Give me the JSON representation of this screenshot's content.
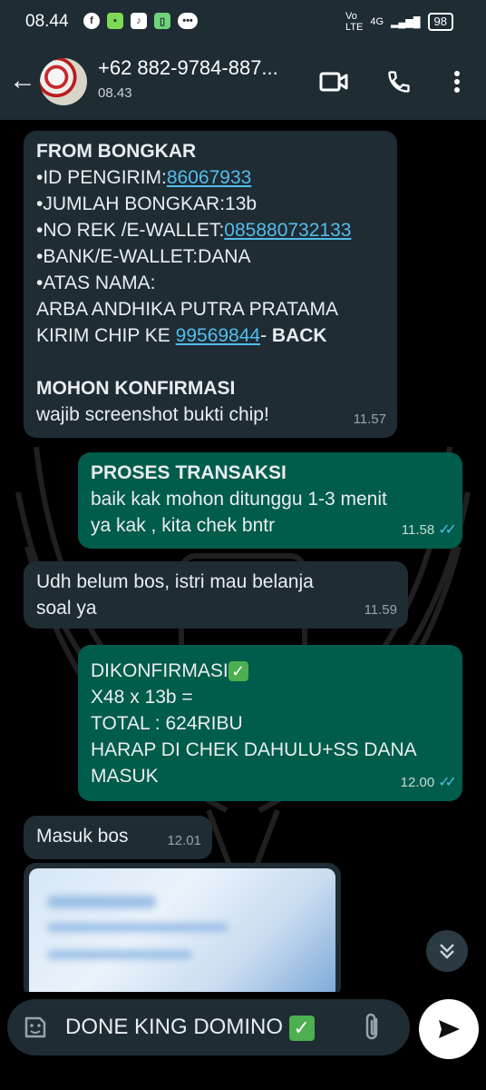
{
  "status_bar": {
    "time": "08.44",
    "network": "4G",
    "battery": "98"
  },
  "header": {
    "contact": "+62 882-9784-887...",
    "last_seen": "08.43"
  },
  "messages": [
    {
      "direction": "in",
      "title": "FROM BONGKAR",
      "id_label": "•ID PENGIRIM:",
      "id_value": "86067933",
      "amount": "•JUMLAH BONGKAR:13b",
      "rek_label": "•NO REK /E-WALLET:",
      "rek_value": "085880732133",
      "bank": "•BANK/E-WALLET:DANA",
      "atas_nama": "•ATAS NAMA:",
      "name": "ARBA ANDHIKA PUTRA PRATAMA",
      "kirim_label": "KIRIM CHIP KE ",
      "kirim_value": "99569844",
      "kirim_suffix": "- ",
      "back": "BACK",
      "confirm_title": "MOHON KONFIRMASI",
      "confirm_text": "wajib screenshot bukti chip!",
      "time": "11.57"
    },
    {
      "direction": "out",
      "title": "PROSES TRANSAKSI",
      "line1": "baik kak mohon ditunggu 1-3 menit",
      "line2": "ya kak , kita chek bntr",
      "time": "11.58"
    },
    {
      "direction": "in",
      "line1": "Udh belum bos, istri mau belanja",
      "line2": "soal ya",
      "time": "11.59"
    },
    {
      "direction": "out",
      "line1": "DIKONFIRMASI",
      "line2": "X48 x 13b =",
      "line3": "TOTAL : 624RIBU",
      "line4": "HARAP DI CHEK DAHULU+SS DANA",
      "line5": "MASUK",
      "time": "12.00"
    },
    {
      "direction": "in",
      "text": "Masuk bos",
      "time": "12.01"
    }
  ],
  "composer": {
    "text": "DONE KING DOMINO"
  },
  "colors": {
    "incoming": "#1f2c34",
    "outgoing": "#005c4b",
    "link": "#53bdeb",
    "read_ticks": "#53bdeb"
  },
  "icons": [
    "back-arrow-icon",
    "video-call-icon",
    "phone-icon",
    "more-vert-icon",
    "sticker-icon",
    "attach-icon",
    "send-icon",
    "scroll-down-icon"
  ]
}
